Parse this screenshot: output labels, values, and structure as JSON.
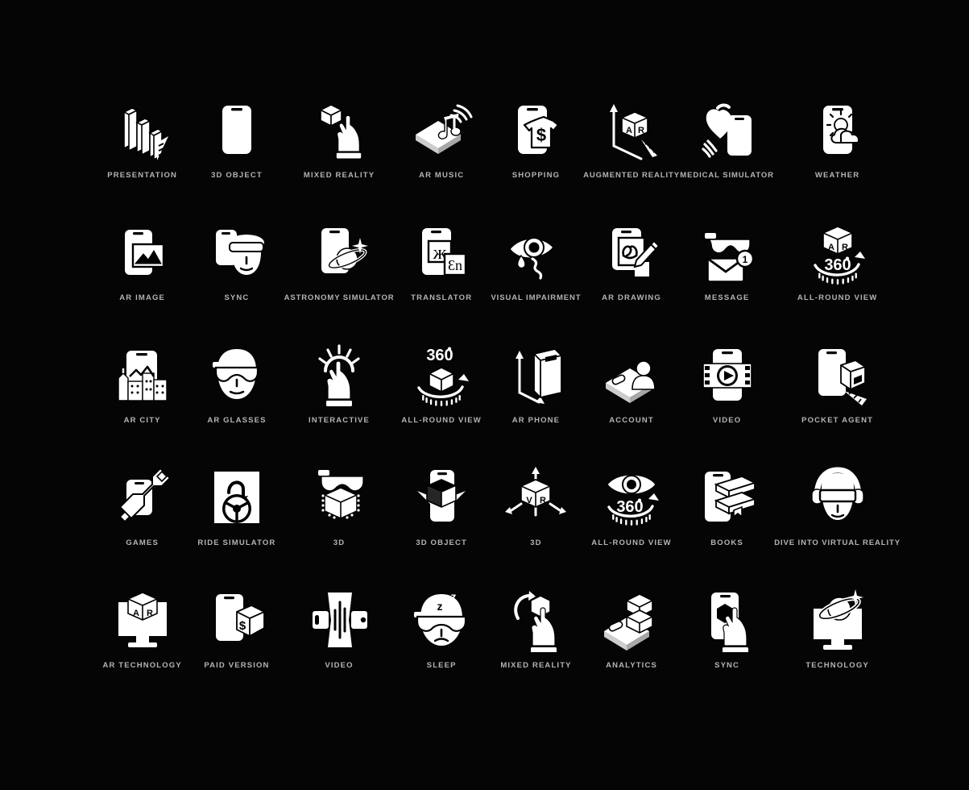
{
  "page": {
    "background_color": "#050505",
    "icon_color": "#ffffff",
    "label_color": "#b4b4b4",
    "columns": 8,
    "rows": 5,
    "total_icons": 40,
    "theme": "Augmented Reality / Virtual Reality glyph icon set (dark)"
  },
  "icons": [
    {
      "label": "PRESENTATION",
      "icon": "bar-chart-3d-icon",
      "row": 1,
      "col": 1
    },
    {
      "label": "3D OBJECT",
      "icon": "phone-cube-icon",
      "row": 1,
      "col": 2
    },
    {
      "label": "MIXED REALITY",
      "icon": "hand-cube-icon",
      "row": 1,
      "col": 3
    },
    {
      "label": "AR MUSIC",
      "icon": "phone-music-note-icon",
      "row": 1,
      "col": 4
    },
    {
      "label": "SHOPPING",
      "icon": "phone-tshirt-dollar-icon",
      "row": 1,
      "col": 5
    },
    {
      "label": "AUGMENTED REALITY",
      "icon": "ar-cube-axes-icon",
      "row": 1,
      "col": 6
    },
    {
      "label": "MEDICAL SIMULATOR",
      "icon": "phone-heart-icon",
      "row": 1,
      "col": 7
    },
    {
      "label": "WEATHER",
      "icon": "phone-sun-cloud-icon",
      "row": 1,
      "col": 8
    },
    {
      "label": "AR IMAGE",
      "icon": "phone-photo-icon",
      "row": 2,
      "col": 1
    },
    {
      "label": "SYNC",
      "icon": "phone-vr-head-icon",
      "row": 2,
      "col": 2
    },
    {
      "label": "ASTRONOMY SIMULATOR",
      "icon": "phone-planet-icon",
      "row": 2,
      "col": 3
    },
    {
      "label": "TRANSLATOR",
      "icon": "phone-translate-icon",
      "row": 2,
      "col": 4
    },
    {
      "label": "VISUAL IMPAIRMENT",
      "icon": "eye-tear-icon",
      "row": 2,
      "col": 5
    },
    {
      "label": "AR DRAWING",
      "icon": "phone-pencil-draw-icon",
      "row": 2,
      "col": 6
    },
    {
      "label": "MESSAGE",
      "icon": "glasses-envelope-badge-icon",
      "row": 2,
      "col": 7
    },
    {
      "label": "ALL-ROUND VIEW",
      "icon": "ar-cube-360-icon",
      "row": 2,
      "col": 8
    },
    {
      "label": "AR CITY",
      "icon": "phone-city-icon",
      "row": 3,
      "col": 1
    },
    {
      "label": "AR GLASSES",
      "icon": "face-ar-glasses-icon",
      "row": 3,
      "col": 2
    },
    {
      "label": "INTERACTIVE",
      "icon": "hand-tap-icon",
      "row": 3,
      "col": 3
    },
    {
      "label": "ALL-ROUND VIEW",
      "icon": "cube-360-icon",
      "row": 3,
      "col": 4
    },
    {
      "label": "AR PHONE",
      "icon": "phone-axes-icon",
      "row": 3,
      "col": 5
    },
    {
      "label": "ACCOUNT",
      "icon": "phone-user-icon",
      "row": 3,
      "col": 6
    },
    {
      "label": "VIDEO",
      "icon": "phone-film-play-icon",
      "row": 3,
      "col": 7
    },
    {
      "label": "POCKET AGENT",
      "icon": "phone-box-measure-icon",
      "row": 3,
      "col": 8
    },
    {
      "label": "GAMES",
      "icon": "phone-joystick-icon",
      "row": 4,
      "col": 1
    },
    {
      "label": "RIDE SIMULATOR",
      "icon": "steering-wheel-icon",
      "row": 4,
      "col": 2
    },
    {
      "label": "3D",
      "icon": "glasses-cube-icon",
      "row": 4,
      "col": 3
    },
    {
      "label": "3D OBJECT",
      "icon": "phone-cube-arrows-icon",
      "row": 4,
      "col": 4
    },
    {
      "label": "3D",
      "icon": "vr-cube-axes-icon",
      "row": 4,
      "col": 5
    },
    {
      "label": "ALL-ROUND VIEW",
      "icon": "eye-360-icon",
      "row": 4,
      "col": 6
    },
    {
      "label": "BOOKS",
      "icon": "phone-books-icon",
      "row": 4,
      "col": 7
    },
    {
      "label": "DIVE INTO VIRTUAL REALITY",
      "icon": "head-vr-headset-icon",
      "row": 4,
      "col": 8
    },
    {
      "label": "AR TECHNOLOGY",
      "icon": "monitor-ar-cube-icon",
      "row": 5,
      "col": 1
    },
    {
      "label": "PAID VERSION",
      "icon": "phone-dollar-box-icon",
      "row": 5,
      "col": 2
    },
    {
      "label": "VIDEO",
      "icon": "phone-landscape-waveform-icon",
      "row": 5,
      "col": 3
    },
    {
      "label": "SLEEP",
      "icon": "face-vr-sleep-icon",
      "row": 5,
      "col": 4
    },
    {
      "label": "MIXED REALITY",
      "icon": "hand-rotate-cube-icon",
      "row": 5,
      "col": 5
    },
    {
      "label": "ANALYTICS",
      "icon": "phone-stacked-boxes-icon",
      "row": 5,
      "col": 6
    },
    {
      "label": "SYNC",
      "icon": "phone-hand-hexagon-icon",
      "row": 5,
      "col": 7
    },
    {
      "label": "TECHNOLOGY",
      "icon": "monitor-planet-icon",
      "row": 5,
      "col": 8
    }
  ]
}
